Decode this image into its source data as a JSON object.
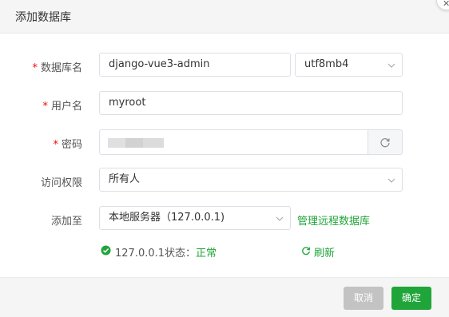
{
  "dialog": {
    "title": "添加数据库",
    "close_icon": "close-icon"
  },
  "form": {
    "db_name": {
      "label": "数据库名",
      "required": true,
      "value": "django-vue3-admin"
    },
    "charset": {
      "value": "utf8mb4",
      "icon": "chevron-down-icon"
    },
    "username": {
      "label": "用户名",
      "required": true,
      "value": "myroot"
    },
    "password": {
      "label": "密码",
      "required": true,
      "value_visible": false,
      "refresh_icon": "refresh-icon"
    },
    "access": {
      "label": "访问权限",
      "value": "所有人",
      "icon": "chevron-down-icon"
    },
    "add_to": {
      "label": "添加至",
      "value": "本地服务器（127.0.0.1)",
      "icon": "chevron-down-icon"
    },
    "manage_remote_link": "管理远程数据库"
  },
  "status": {
    "prefix": "127.0.0.1状态：",
    "value": "正常",
    "icon": "check-circle-icon",
    "refresh_label": "刷新"
  },
  "footer": {
    "cancel_label": "取消",
    "ok_label": "确定"
  },
  "colors": {
    "accent": "#20a53a",
    "required": "#ef0808",
    "cancel_bg": "#c3c3c3"
  }
}
